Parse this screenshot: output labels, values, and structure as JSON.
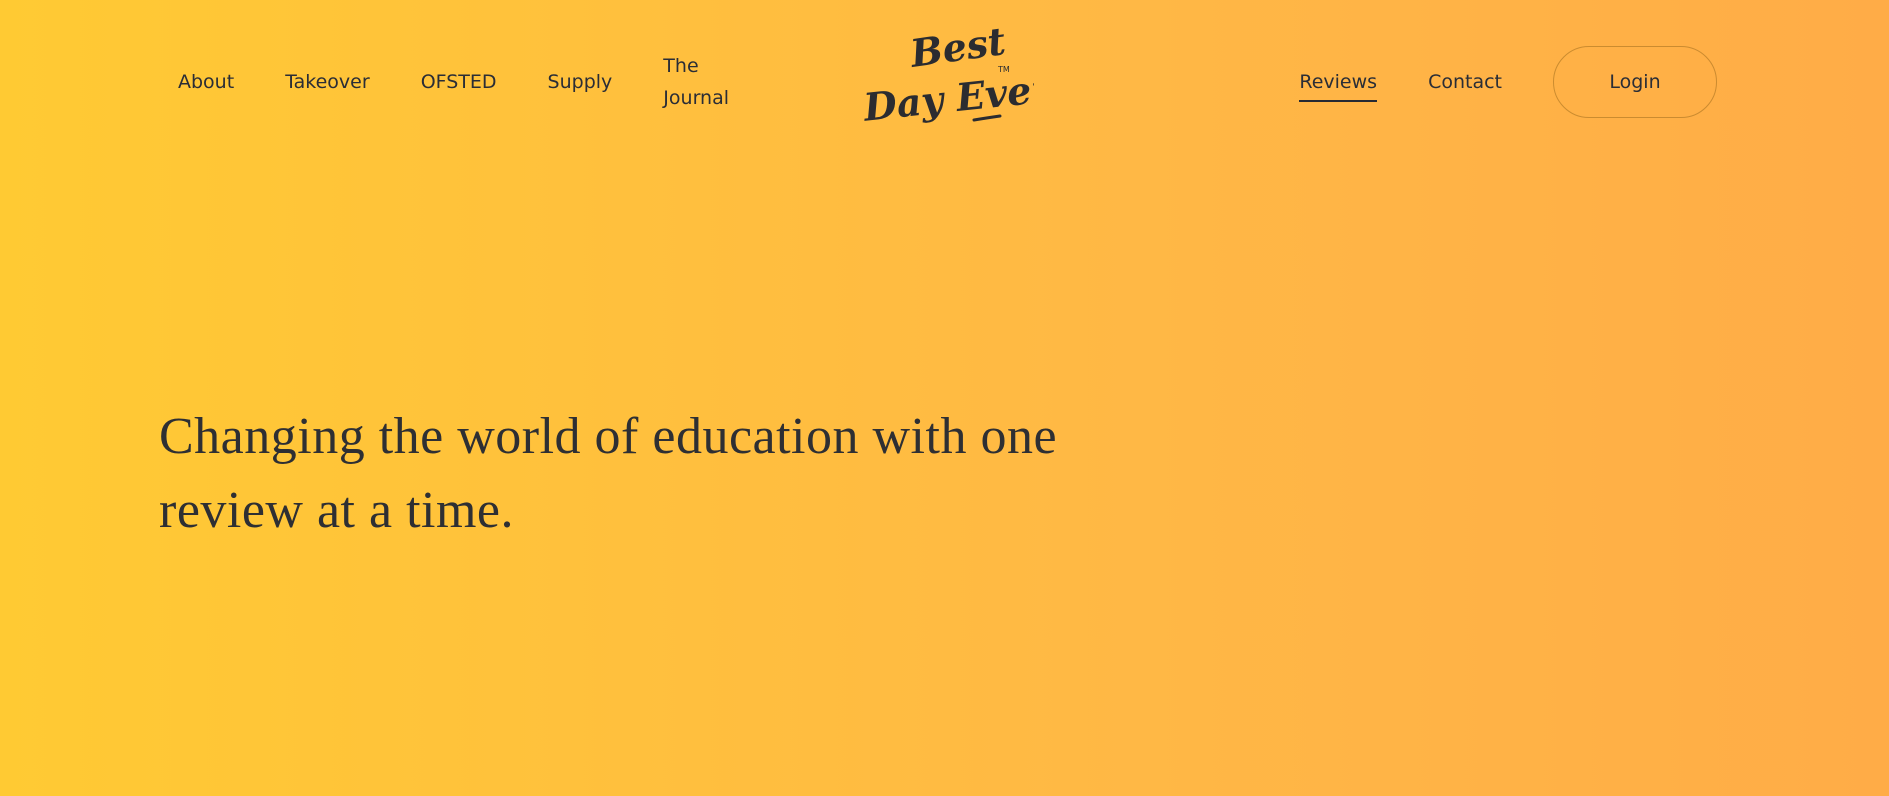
{
  "nav_left": [
    {
      "label": "About"
    },
    {
      "label": "Takeover"
    },
    {
      "label": "OFSTED"
    },
    {
      "label": "Supply"
    },
    {
      "label": "The Journal"
    }
  ],
  "logo": {
    "line1": "Best",
    "line2": "Day Ever.",
    "mark": "TM"
  },
  "nav_right": [
    {
      "label": "Reviews",
      "active": true
    },
    {
      "label": "Contact"
    }
  ],
  "login": {
    "label": "Login"
  },
  "hero": {
    "heading": "Changing the world of education with one review at a time."
  },
  "colors": {
    "gradient_start": "#ffca33",
    "gradient_end": "#ffac47",
    "text": "#262a33"
  }
}
